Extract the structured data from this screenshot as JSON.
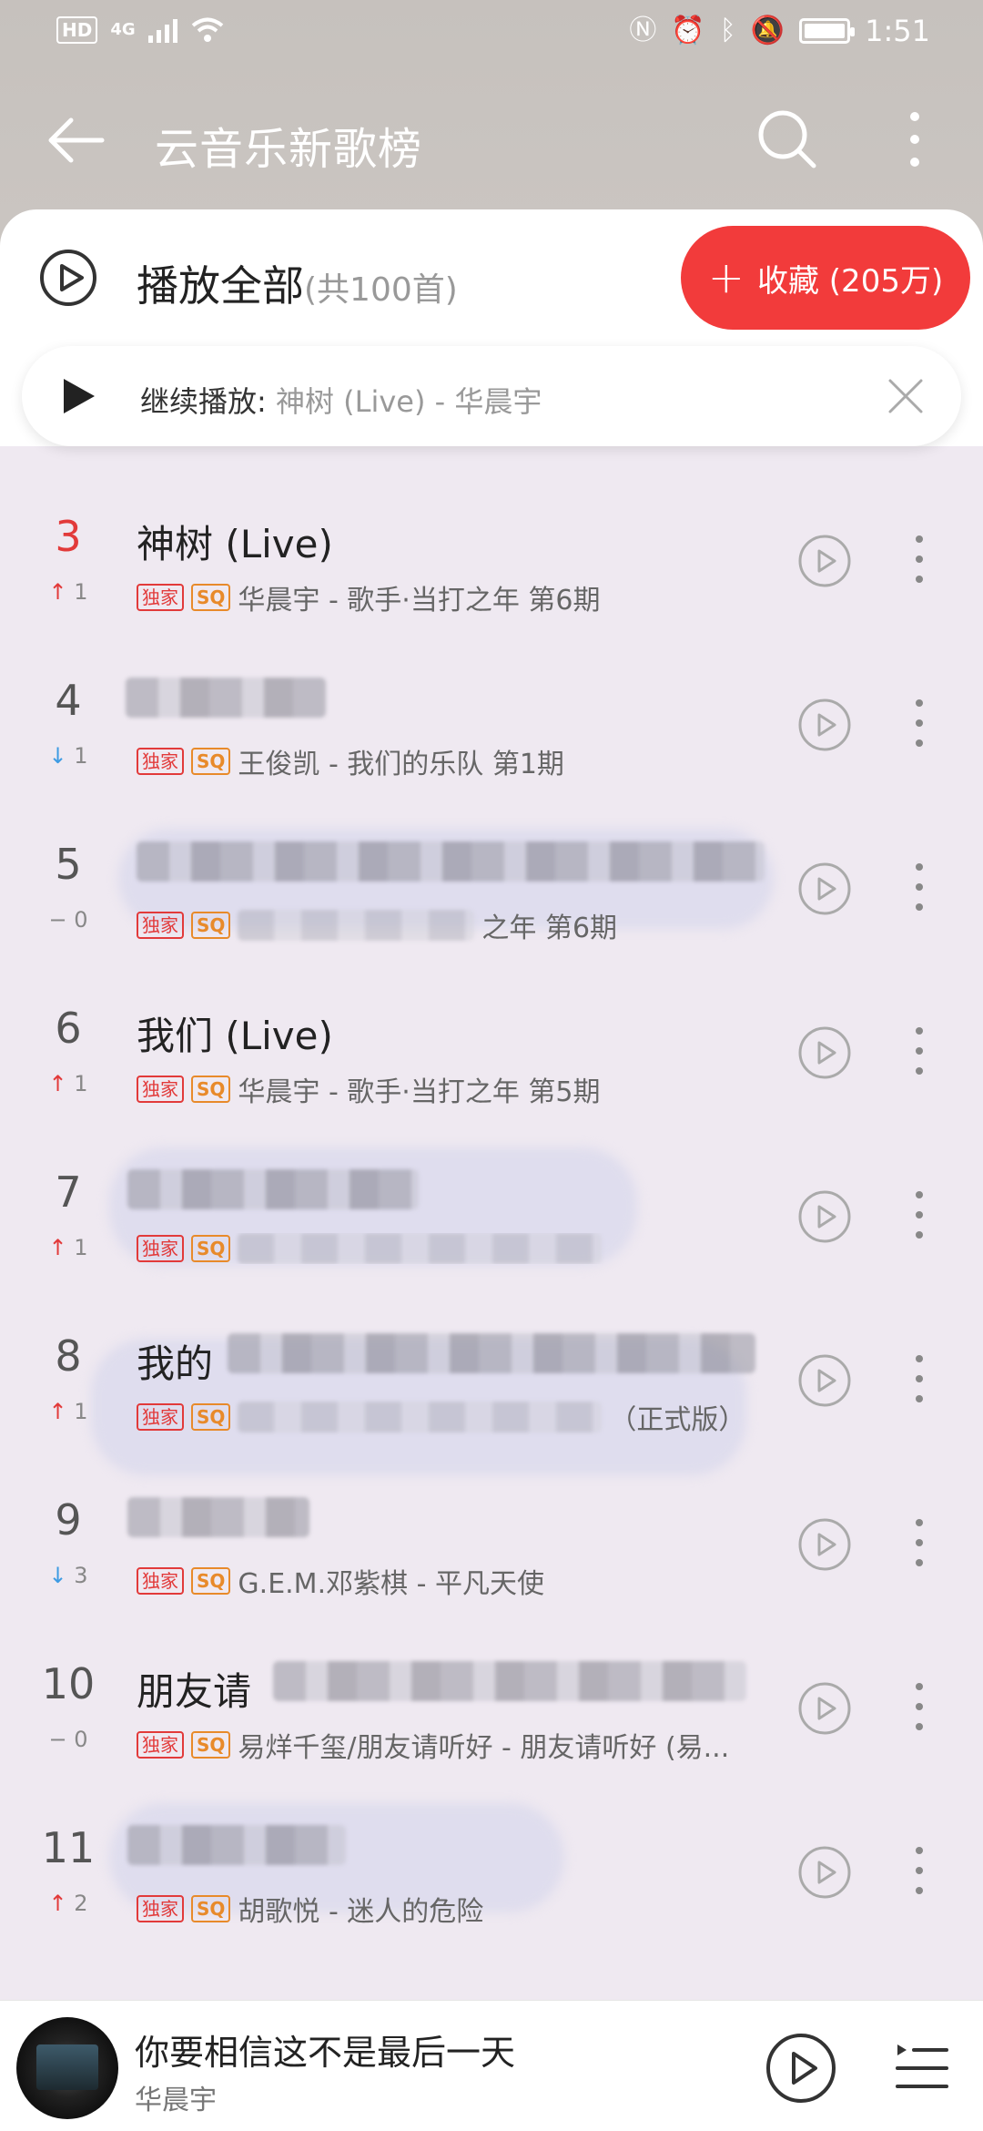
{
  "status_bar": {
    "hd": "HD",
    "net": "4G",
    "time": "1:51",
    "icons": [
      "nfc-icon",
      "alarm-icon",
      "bluetooth-icon",
      "mute-icon",
      "battery-icon"
    ]
  },
  "header": {
    "title": "云音乐新歌榜"
  },
  "play_all": {
    "label": "播放全部",
    "count": "(共100首)"
  },
  "favorite": {
    "plus": "+",
    "label": "收藏 (205万)"
  },
  "resume": {
    "label": "继续播放:",
    "song": "神树 (Live) - 华晨宇"
  },
  "songs": [
    {
      "rank": "3",
      "trend": "1",
      "trend_dir": "up",
      "title": "神树 (Live)",
      "tags": [
        "独家",
        "SQ"
      ],
      "sub": "华晨宇 - 歌手·当打之年 第6期"
    },
    {
      "rank": "4",
      "trend": "1",
      "trend_dir": "down",
      "title": "",
      "tags": [
        "独家",
        "SQ"
      ],
      "sub": "王俊凯 - 我们的乐队 第1期"
    },
    {
      "rank": "5",
      "trend": "0",
      "trend_dir": "same",
      "title": "",
      "tags": [
        "独家",
        "SQ"
      ],
      "sub": "之年 第6期"
    },
    {
      "rank": "6",
      "trend": "1",
      "trend_dir": "up",
      "title": "我们 (Live)",
      "tags": [
        "独家",
        "SQ"
      ],
      "sub": "华晨宇 - 歌手·当打之年 第5期"
    },
    {
      "rank": "7",
      "trend": "1",
      "trend_dir": "up",
      "title": "",
      "tags": [
        "独家",
        "SQ"
      ],
      "sub": ""
    },
    {
      "rank": "8",
      "trend": "1",
      "trend_dir": "up",
      "title": "我的",
      "tags": [
        "独家",
        "SQ"
      ],
      "sub": "（正式版）"
    },
    {
      "rank": "9",
      "trend": "3",
      "trend_dir": "down",
      "title": "",
      "tags": [
        "独家",
        "SQ"
      ],
      "sub": "G.E.M.邓紫棋 - 平凡天使"
    },
    {
      "rank": "10",
      "trend": "0",
      "trend_dir": "same",
      "title": "朋友请",
      "tags": [
        "独家",
        "SQ"
      ],
      "sub": "易烊千玺/朋友请听好 - 朋友请听好 (易..."
    },
    {
      "rank": "11",
      "trend": "2",
      "trend_dir": "up",
      "title": "",
      "tags": [
        "独家",
        "SQ"
      ],
      "sub": "胡歌悦 - 迷人的危险"
    }
  ],
  "mini_player": {
    "title": "你要相信这不是最后一天",
    "artist": "华晨宇"
  },
  "colors": {
    "accent_red": "#f23b3b",
    "trend_down": "#3d9be3",
    "sq_orange": "#e88a2a"
  }
}
